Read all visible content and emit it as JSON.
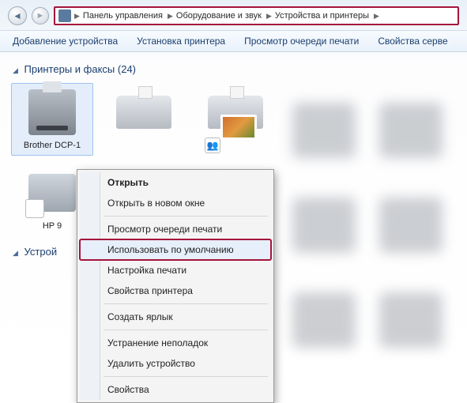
{
  "breadcrumb": {
    "root_icon": "control-panel",
    "items": [
      "Панель управления",
      "Оборудование и звук",
      "Устройства и принтеры"
    ]
  },
  "toolbar": {
    "add_device": "Добавление устройства",
    "install_printer": "Установка принтера",
    "view_queue": "Просмотр очереди печати",
    "server_props": "Свойства серве"
  },
  "sections": {
    "printers": {
      "title": "Принтеры и факсы",
      "count": "(24)"
    },
    "devices": {
      "title": "Устрой"
    }
  },
  "devices": [
    {
      "name": "Brother DCP-1"
    },
    {
      "name": "HP 9"
    }
  ],
  "context_menu": {
    "open": "Открыть",
    "open_new": "Открыть в новом окне",
    "view_queue": "Просмотр очереди печати",
    "set_default": "Использовать по умолчанию",
    "print_settings": "Настройка печати",
    "printer_props": "Свойства принтера",
    "create_shortcut": "Создать ярлык",
    "troubleshoot": "Устранение неполадок",
    "remove": "Удалить устройство",
    "properties": "Свойства"
  },
  "annotation": {
    "highlight_breadcrumb": true,
    "highlight_set_default": true
  }
}
